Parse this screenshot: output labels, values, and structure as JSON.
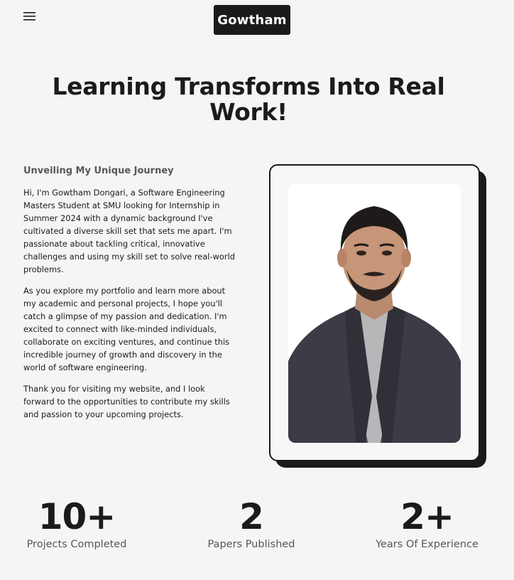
{
  "nav": {
    "menu_icon": "hamburger-menu-icon",
    "logo_text": "Gowtham"
  },
  "hero": {
    "headline": "Learning Transforms Into Real Work!"
  },
  "bio": {
    "title": "Unveiling My Unique Journey",
    "paragraphs": [
      "Hi, I'm Gowtham Dongari, a Software Engineering Masters Student at SMU looking for Internship in Summer 2024 with a dynamic background I've cultivated a diverse skill set that sets me apart. I'm passionate about tackling critical, innovative challenges and using my skill set to solve real-world problems.",
      "As you explore my portfolio and learn more about my academic and personal projects, I hope you'll catch a glimpse of my passion and dedication. I'm excited to connect with like-minded individuals, collaborate on exciting ventures, and continue this incredible journey of growth and discovery in the world of software engineering.",
      "Thank you for visiting my website, and I look forward to the opportunities to contribute my skills and passion to your upcoming projects."
    ]
  },
  "stats": [
    {
      "value": "10+",
      "label": "Projects Completed"
    },
    {
      "value": "2",
      "label": "Papers Published"
    },
    {
      "value": "2+",
      "label": "Years Of Experience"
    }
  ],
  "colors": {
    "background": "#f5f5f5",
    "dark": "#1b1b1b",
    "muted": "#575757"
  }
}
